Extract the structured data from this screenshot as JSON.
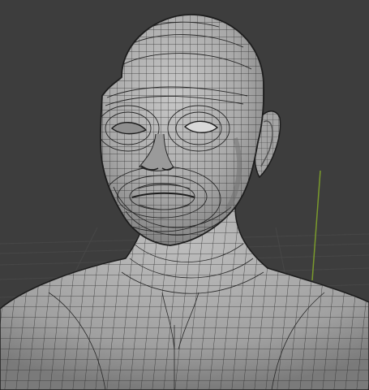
{
  "viewport": {
    "mode": "3d-viewport",
    "shading": "solid",
    "overlay": "wireframe"
  },
  "colors": {
    "background": "#3d3d3d",
    "grid_line": "#4a4a4a",
    "axis_y": "#7a9a2c",
    "mesh_fill": "#a6a6a6",
    "mesh_light": "#c3c3c3",
    "mesh_dark": "#707070",
    "wire": "#2b2b2b",
    "outline": "#1c1c1c"
  },
  "icons": {
    "mesh": "human-head-mesh",
    "axis": "y-axis-line"
  }
}
